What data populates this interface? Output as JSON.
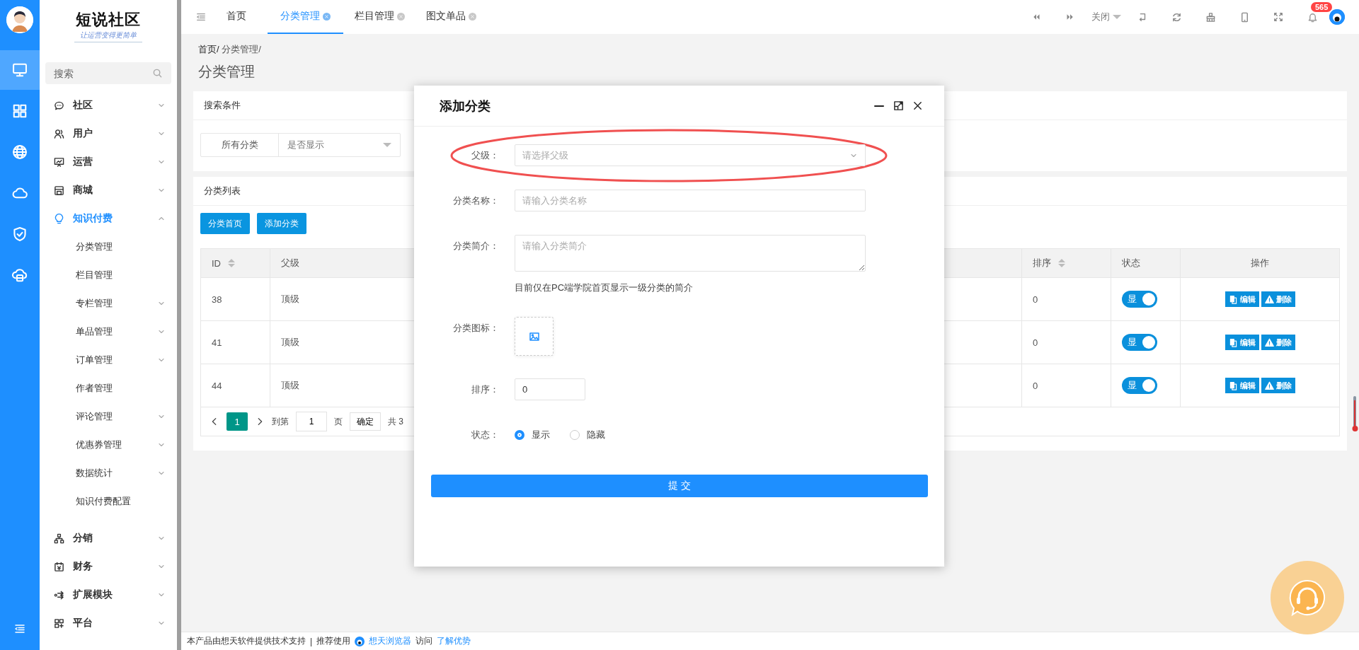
{
  "logo": {
    "title": "短说社区",
    "tagline": "让运营变得更简单"
  },
  "rail": [
    {
      "selected": true
    },
    {
      "selected": false
    },
    {
      "selected": false
    },
    {
      "selected": false
    },
    {
      "selected": false
    },
    {
      "selected": false
    }
  ],
  "sidebar": {
    "search": {
      "placeholder": "搜索"
    },
    "items": [
      {
        "label": "社区",
        "expanded": false,
        "selected": false
      },
      {
        "label": "用户",
        "expanded": false,
        "selected": false
      },
      {
        "label": "运营",
        "expanded": false,
        "selected": false
      },
      {
        "label": "商城",
        "expanded": false,
        "selected": false
      },
      {
        "label": "知识付费",
        "expanded": true,
        "selected": true,
        "children": [
          {
            "label": "分类管理",
            "has_submenu": false
          },
          {
            "label": "栏目管理",
            "has_submenu": false
          },
          {
            "label": "专栏管理",
            "has_submenu": true
          },
          {
            "label": "单品管理",
            "has_submenu": true
          },
          {
            "label": "订单管理",
            "has_submenu": true
          },
          {
            "label": "作者管理",
            "has_submenu": false
          },
          {
            "label": "评论管理",
            "has_submenu": true
          },
          {
            "label": "优惠券管理",
            "has_submenu": true
          },
          {
            "label": "数据统计",
            "has_submenu": true
          },
          {
            "label": "知识付费配置",
            "has_submenu": false
          }
        ]
      },
      {
        "label": "分销",
        "expanded": false,
        "selected": false
      },
      {
        "label": "财务",
        "expanded": false,
        "selected": false
      },
      {
        "label": "扩展模块",
        "expanded": false,
        "selected": false
      },
      {
        "label": "平台",
        "expanded": false,
        "selected": false
      }
    ]
  },
  "tabs": [
    {
      "label": "首页",
      "selected": false,
      "closable": false
    },
    {
      "label": "分类管理",
      "selected": true,
      "closable": true
    },
    {
      "label": "栏目管理",
      "selected": false,
      "closable": true
    },
    {
      "label": "图文单品",
      "selected": false,
      "closable": true
    }
  ],
  "toolbar": {
    "close_menu": "关闭",
    "notifications": "565"
  },
  "breadcrumb": [
    "首页/",
    "分类管理/"
  ],
  "page_title": "分类管理",
  "search_card": {
    "title": "搜索条件",
    "filter_label": "所有分类",
    "filter_placeholder": "是否显示"
  },
  "list_card": {
    "title": "分类列表",
    "buttons": [
      "分类首页",
      "添加分类"
    ],
    "columns": [
      {
        "label": "ID",
        "sortable": true
      },
      {
        "label": "父级",
        "sortable": false
      },
      {
        "label": "排序",
        "sortable": true
      },
      {
        "label": "状态",
        "sortable": false
      },
      {
        "label": "操作",
        "sortable": false
      }
    ],
    "rows": [
      {
        "id": "38",
        "parent": "顶级",
        "sort": "0",
        "status": {
          "label": "显",
          "on": true
        },
        "actions": [
          {
            "kind": "edit",
            "label": "编辑"
          },
          {
            "kind": "delete",
            "label": "删除"
          }
        ]
      },
      {
        "id": "41",
        "parent": "顶级",
        "sort": "0",
        "status": {
          "label": "显",
          "on": true
        },
        "actions": [
          {
            "kind": "edit",
            "label": "编辑"
          },
          {
            "kind": "delete",
            "label": "删除"
          }
        ]
      },
      {
        "id": "44",
        "parent": "顶级",
        "sort": "0",
        "status": {
          "label": "显",
          "on": true
        },
        "actions": [
          {
            "kind": "edit",
            "label": "编辑"
          },
          {
            "kind": "delete",
            "label": "删除"
          }
        ]
      }
    ],
    "pagination": {
      "pages": [
        {
          "label": "1",
          "selected": true
        }
      ],
      "goto": "到第",
      "page_value": "1",
      "page_unit": "页",
      "confirm": "确定",
      "total": "共 3"
    }
  },
  "modal": {
    "title": "添加分类",
    "fields": [
      {
        "kind": "select",
        "label": "父级：",
        "placeholder": "请选择父级",
        "highlighted": true
      },
      {
        "kind": "text",
        "label": "分类名称：",
        "placeholder": "请输入分类名称"
      },
      {
        "kind": "textarea",
        "label": "分类简介：",
        "placeholder": "请输入分类简介",
        "hint": "目前仅在PC端学院首页显示一级分类的简介"
      },
      {
        "kind": "upload",
        "label": "分类图标："
      },
      {
        "kind": "number",
        "label": "排序：",
        "value": "0"
      },
      {
        "kind": "radio",
        "label": "状态：",
        "options": [
          {
            "label": "显示",
            "selected": true
          },
          {
            "label": "隐藏",
            "selected": false
          }
        ]
      }
    ],
    "submit": "提 交"
  },
  "footer": {
    "credit": "本产品由想天软件提供技术支持",
    "separator": "|",
    "recommend": "推荐使用",
    "browser": "想天浏览器",
    "visit": "访问",
    "link": "了解优势"
  }
}
